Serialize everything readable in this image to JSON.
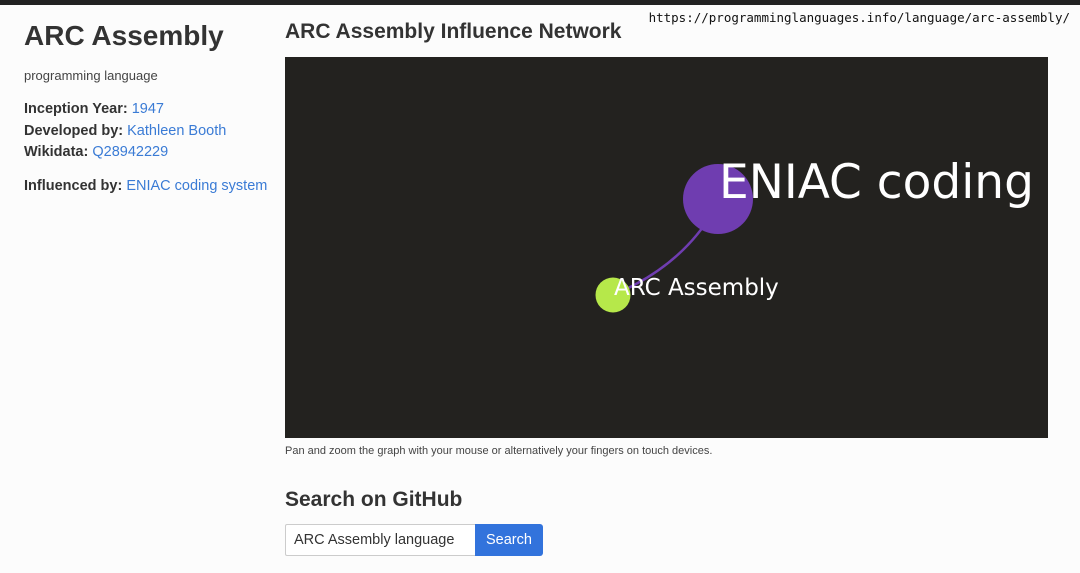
{
  "url": "https://programminglanguages.info/language/arc-assembly/",
  "sidebar": {
    "title": "ARC Assembly",
    "subtitle": "programming language",
    "inception_label": "Inception Year:",
    "inception_value": "1947",
    "developer_label": "Developed by:",
    "developer_value": "Kathleen Booth",
    "wikidata_label": "Wikidata:",
    "wikidata_value": "Q28942229",
    "influenced_label": "Influenced by:",
    "influenced_value": "ENIAC coding system"
  },
  "main": {
    "title": "ARC Assembly Influence Network",
    "graph": {
      "background": "#23221f",
      "nodes": [
        {
          "label": "ENIAC coding s",
          "color": "#6f3db0"
        },
        {
          "label": "ARC Assembly",
          "color": "#b6e84a"
        }
      ],
      "edge_color": "#6f3db0"
    },
    "caption": "Pan and zoom the graph with your mouse or alternatively your fingers on touch devices.",
    "github": {
      "title": "Search on GitHub",
      "input_value": "ARC Assembly language",
      "button_label": "Search"
    }
  }
}
